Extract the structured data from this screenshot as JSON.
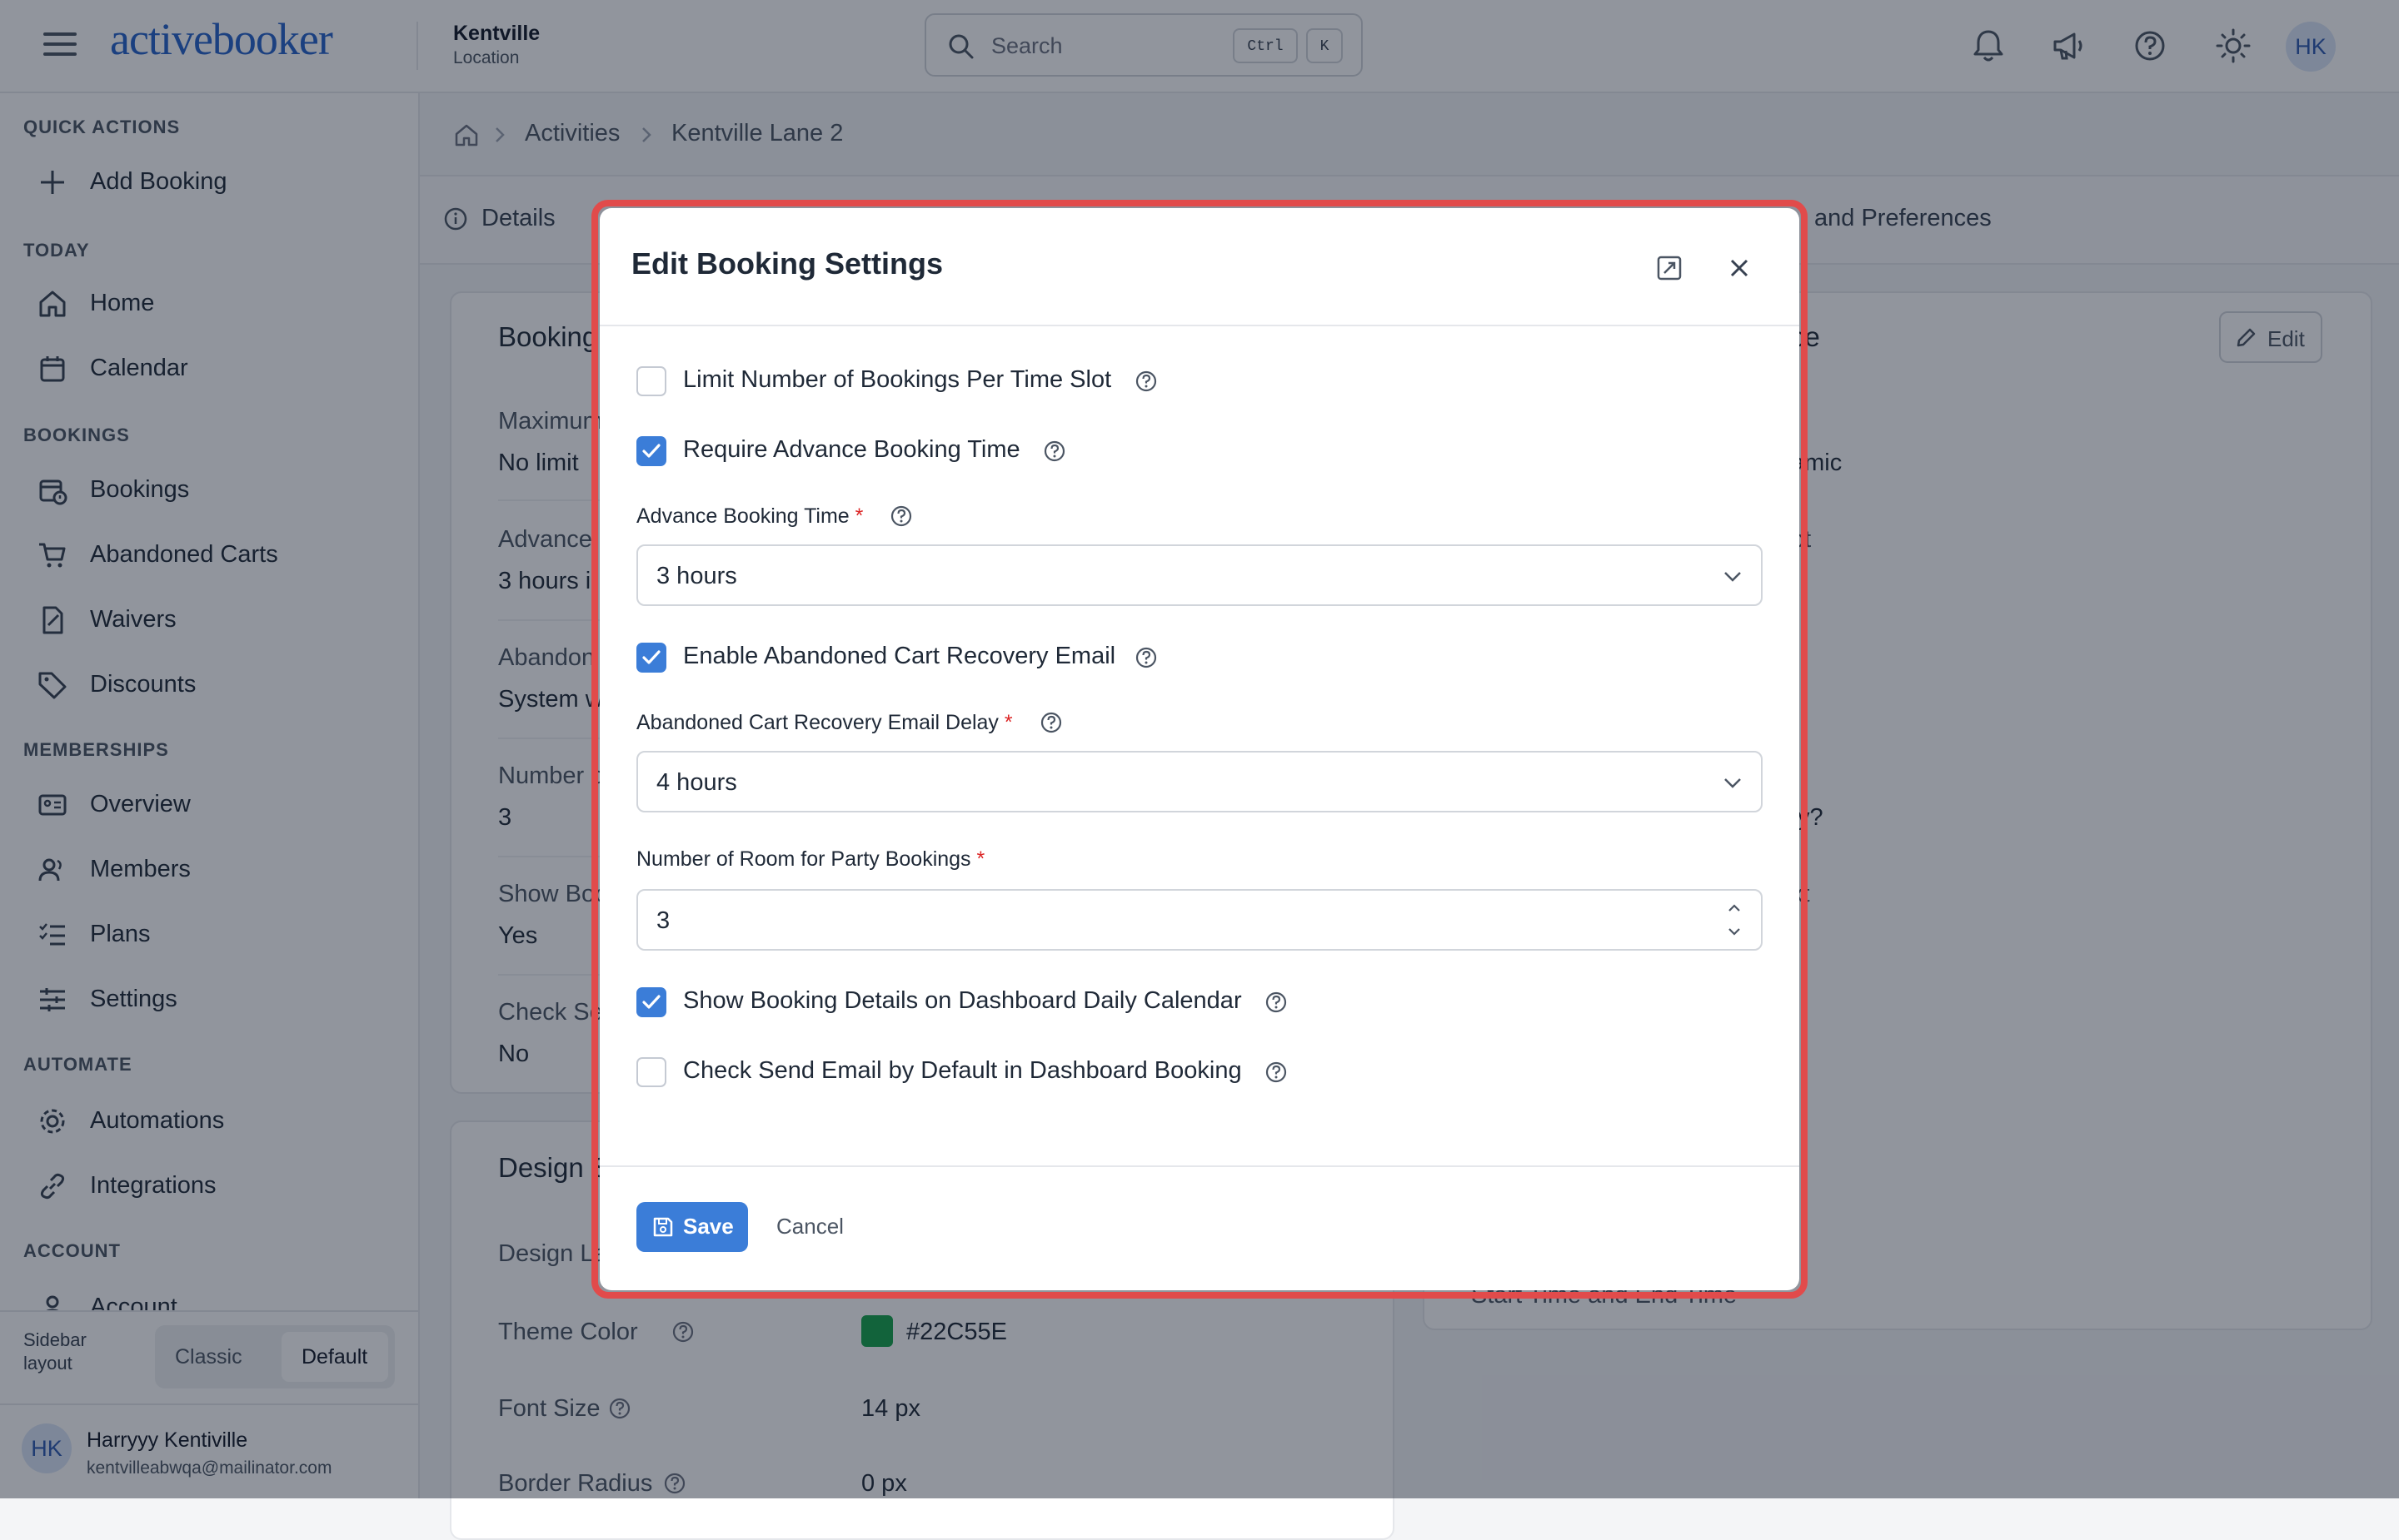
{
  "header": {
    "logo": "activebooker",
    "location_name": "Kentville",
    "location_sub": "Location",
    "search_placeholder": "Search",
    "kbd_ctrl": "Ctrl",
    "kbd_k": "K",
    "avatar": "HK"
  },
  "sidebar": {
    "sections": {
      "quick_actions": "QUICK ACTIONS",
      "today": "TODAY",
      "bookings": "BOOKINGS",
      "memberships": "MEMBERSHIPS",
      "automate": "AUTOMATE",
      "account": "ACCOUNT"
    },
    "items": {
      "add_booking": "Add Booking",
      "home": "Home",
      "calendar": "Calendar",
      "bookings": "Bookings",
      "abandoned_carts": "Abandoned Carts",
      "waivers": "Waivers",
      "discounts": "Discounts",
      "overview": "Overview",
      "members": "Members",
      "plans": "Plans",
      "settings": "Settings",
      "automations": "Automations",
      "integrations": "Integrations",
      "account": "Account"
    },
    "layout_label_1": "Sidebar",
    "layout_label_2": "layout",
    "layout_classic": "Classic",
    "layout_default": "Default",
    "user_initials": "HK",
    "user_name": "Harryyy Kentiville",
    "user_email": "kentvilleabwqa@mailinator.com"
  },
  "breadcrumb": {
    "activities": "Activities",
    "current": "Kentville Lane 2"
  },
  "tabs": {
    "details": "Details",
    "partial": "and Preferences"
  },
  "booking_card": {
    "title_partial": "Booking",
    "rows": [
      {
        "label": "Maximum",
        "value": "No limit"
      },
      {
        "label": "Advance",
        "value": "3 hours i"
      },
      {
        "label": "Abandon",
        "value": "System w"
      },
      {
        "label": "Number o",
        "value": "3"
      },
      {
        "label": "Show Boo",
        "value": "Yes"
      },
      {
        "label": "Check Se",
        "value": "No"
      }
    ]
  },
  "right_card": {
    "title_partial": "ce",
    "edit": "Edit",
    "frag_1": "amic",
    "frag_2": "pt",
    "frag_3": "ty?",
    "frag_4": "xt",
    "frag_5": "Start Time and End Time"
  },
  "design_card": {
    "title_partial": "Design S",
    "design_layout": "Design La",
    "theme_color_label": "Theme Color",
    "theme_color_value": "#22C55E",
    "theme_color_swatch": "#16a34a",
    "font_size_label": "Font Size",
    "font_size_value": "14 px",
    "border_radius_label": "Border Radius",
    "border_radius_value": "0 px"
  },
  "modal": {
    "title": "Edit Booking Settings",
    "limit_label": "Limit Number of Bookings Per Time Slot",
    "limit_checked": false,
    "require_label": "Require Advance Booking Time",
    "require_checked": true,
    "advance_label": "Advance Booking Time",
    "advance_value": "3 hours",
    "enable_label": "Enable Abandoned Cart Recovery Email",
    "enable_checked": true,
    "delay_label": "Abandoned Cart Recovery Email Delay",
    "delay_value": "4 hours",
    "rooms_label": "Number of Room for Party Bookings",
    "rooms_value": "3",
    "show_label": "Show Booking Details on Dashboard Daily Calendar",
    "show_checked": true,
    "send_label": "Check Send Email by Default in Dashboard Booking",
    "send_checked": false,
    "required_mark": "*",
    "save": "Save",
    "cancel": "Cancel"
  },
  "colors": {
    "accent": "#3b7dd8",
    "highlight": "#e14b4b"
  }
}
